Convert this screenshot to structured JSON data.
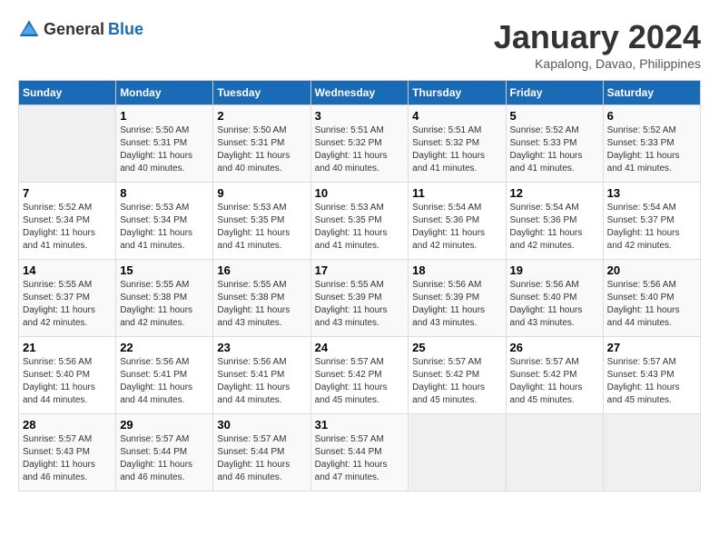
{
  "header": {
    "logo_general": "General",
    "logo_blue": "Blue",
    "month": "January 2024",
    "location": "Kapalong, Davao, Philippines"
  },
  "weekdays": [
    "Sunday",
    "Monday",
    "Tuesday",
    "Wednesday",
    "Thursday",
    "Friday",
    "Saturday"
  ],
  "weeks": [
    [
      {
        "day": "",
        "sunrise": "",
        "sunset": "",
        "daylight": ""
      },
      {
        "day": "1",
        "sunrise": "Sunrise: 5:50 AM",
        "sunset": "Sunset: 5:31 PM",
        "daylight": "Daylight: 11 hours and 40 minutes."
      },
      {
        "day": "2",
        "sunrise": "Sunrise: 5:50 AM",
        "sunset": "Sunset: 5:31 PM",
        "daylight": "Daylight: 11 hours and 40 minutes."
      },
      {
        "day": "3",
        "sunrise": "Sunrise: 5:51 AM",
        "sunset": "Sunset: 5:32 PM",
        "daylight": "Daylight: 11 hours and 40 minutes."
      },
      {
        "day": "4",
        "sunrise": "Sunrise: 5:51 AM",
        "sunset": "Sunset: 5:32 PM",
        "daylight": "Daylight: 11 hours and 41 minutes."
      },
      {
        "day": "5",
        "sunrise": "Sunrise: 5:52 AM",
        "sunset": "Sunset: 5:33 PM",
        "daylight": "Daylight: 11 hours and 41 minutes."
      },
      {
        "day": "6",
        "sunrise": "Sunrise: 5:52 AM",
        "sunset": "Sunset: 5:33 PM",
        "daylight": "Daylight: 11 hours and 41 minutes."
      }
    ],
    [
      {
        "day": "7",
        "sunrise": "Sunrise: 5:52 AM",
        "sunset": "Sunset: 5:34 PM",
        "daylight": "Daylight: 11 hours and 41 minutes."
      },
      {
        "day": "8",
        "sunrise": "Sunrise: 5:53 AM",
        "sunset": "Sunset: 5:34 PM",
        "daylight": "Daylight: 11 hours and 41 minutes."
      },
      {
        "day": "9",
        "sunrise": "Sunrise: 5:53 AM",
        "sunset": "Sunset: 5:35 PM",
        "daylight": "Daylight: 11 hours and 41 minutes."
      },
      {
        "day": "10",
        "sunrise": "Sunrise: 5:53 AM",
        "sunset": "Sunset: 5:35 PM",
        "daylight": "Daylight: 11 hours and 41 minutes."
      },
      {
        "day": "11",
        "sunrise": "Sunrise: 5:54 AM",
        "sunset": "Sunset: 5:36 PM",
        "daylight": "Daylight: 11 hours and 42 minutes."
      },
      {
        "day": "12",
        "sunrise": "Sunrise: 5:54 AM",
        "sunset": "Sunset: 5:36 PM",
        "daylight": "Daylight: 11 hours and 42 minutes."
      },
      {
        "day": "13",
        "sunrise": "Sunrise: 5:54 AM",
        "sunset": "Sunset: 5:37 PM",
        "daylight": "Daylight: 11 hours and 42 minutes."
      }
    ],
    [
      {
        "day": "14",
        "sunrise": "Sunrise: 5:55 AM",
        "sunset": "Sunset: 5:37 PM",
        "daylight": "Daylight: 11 hours and 42 minutes."
      },
      {
        "day": "15",
        "sunrise": "Sunrise: 5:55 AM",
        "sunset": "Sunset: 5:38 PM",
        "daylight": "Daylight: 11 hours and 42 minutes."
      },
      {
        "day": "16",
        "sunrise": "Sunrise: 5:55 AM",
        "sunset": "Sunset: 5:38 PM",
        "daylight": "Daylight: 11 hours and 43 minutes."
      },
      {
        "day": "17",
        "sunrise": "Sunrise: 5:55 AM",
        "sunset": "Sunset: 5:39 PM",
        "daylight": "Daylight: 11 hours and 43 minutes."
      },
      {
        "day": "18",
        "sunrise": "Sunrise: 5:56 AM",
        "sunset": "Sunset: 5:39 PM",
        "daylight": "Daylight: 11 hours and 43 minutes."
      },
      {
        "day": "19",
        "sunrise": "Sunrise: 5:56 AM",
        "sunset": "Sunset: 5:40 PM",
        "daylight": "Daylight: 11 hours and 43 minutes."
      },
      {
        "day": "20",
        "sunrise": "Sunrise: 5:56 AM",
        "sunset": "Sunset: 5:40 PM",
        "daylight": "Daylight: 11 hours and 44 minutes."
      }
    ],
    [
      {
        "day": "21",
        "sunrise": "Sunrise: 5:56 AM",
        "sunset": "Sunset: 5:40 PM",
        "daylight": "Daylight: 11 hours and 44 minutes."
      },
      {
        "day": "22",
        "sunrise": "Sunrise: 5:56 AM",
        "sunset": "Sunset: 5:41 PM",
        "daylight": "Daylight: 11 hours and 44 minutes."
      },
      {
        "day": "23",
        "sunrise": "Sunrise: 5:56 AM",
        "sunset": "Sunset: 5:41 PM",
        "daylight": "Daylight: 11 hours and 44 minutes."
      },
      {
        "day": "24",
        "sunrise": "Sunrise: 5:57 AM",
        "sunset": "Sunset: 5:42 PM",
        "daylight": "Daylight: 11 hours and 45 minutes."
      },
      {
        "day": "25",
        "sunrise": "Sunrise: 5:57 AM",
        "sunset": "Sunset: 5:42 PM",
        "daylight": "Daylight: 11 hours and 45 minutes."
      },
      {
        "day": "26",
        "sunrise": "Sunrise: 5:57 AM",
        "sunset": "Sunset: 5:42 PM",
        "daylight": "Daylight: 11 hours and 45 minutes."
      },
      {
        "day": "27",
        "sunrise": "Sunrise: 5:57 AM",
        "sunset": "Sunset: 5:43 PM",
        "daylight": "Daylight: 11 hours and 45 minutes."
      }
    ],
    [
      {
        "day": "28",
        "sunrise": "Sunrise: 5:57 AM",
        "sunset": "Sunset: 5:43 PM",
        "daylight": "Daylight: 11 hours and 46 minutes."
      },
      {
        "day": "29",
        "sunrise": "Sunrise: 5:57 AM",
        "sunset": "Sunset: 5:44 PM",
        "daylight": "Daylight: 11 hours and 46 minutes."
      },
      {
        "day": "30",
        "sunrise": "Sunrise: 5:57 AM",
        "sunset": "Sunset: 5:44 PM",
        "daylight": "Daylight: 11 hours and 46 minutes."
      },
      {
        "day": "31",
        "sunrise": "Sunrise: 5:57 AM",
        "sunset": "Sunset: 5:44 PM",
        "daylight": "Daylight: 11 hours and 47 minutes."
      },
      {
        "day": "",
        "sunrise": "",
        "sunset": "",
        "daylight": ""
      },
      {
        "day": "",
        "sunrise": "",
        "sunset": "",
        "daylight": ""
      },
      {
        "day": "",
        "sunrise": "",
        "sunset": "",
        "daylight": ""
      }
    ]
  ]
}
